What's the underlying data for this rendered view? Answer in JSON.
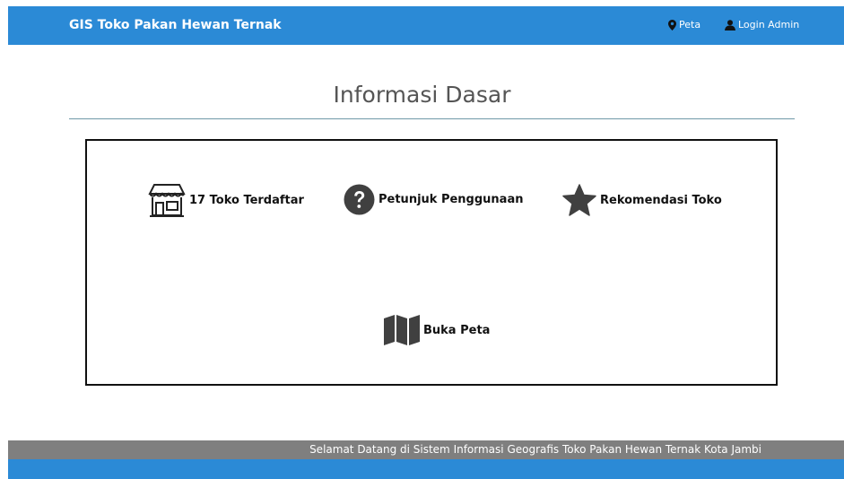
{
  "navbar": {
    "brand": "GIS Toko Pakan Hewan Ternak",
    "links": [
      {
        "label": "Peta",
        "icon": "map-marker-icon"
      },
      {
        "label": "Login Admin",
        "icon": "user-icon"
      }
    ],
    "color": "#2b8ad6"
  },
  "main": {
    "title": "Informasi Dasar",
    "features": [
      {
        "label": "17 Toko Terdaftar",
        "icon": "store-icon"
      },
      {
        "label": "Petunjuk Penggunaan",
        "icon": "question-circle-icon"
      },
      {
        "label": "Rekomendasi Toko",
        "icon": "star-icon"
      },
      {
        "label": "Buka Peta",
        "icon": "map-icon"
      }
    ]
  },
  "footer": {
    "text": "Selamat Datang di Sistem Informasi Geografis Toko Pakan Hewan Ternak Kota Jambi",
    "band_color": "#7f7f7f"
  }
}
